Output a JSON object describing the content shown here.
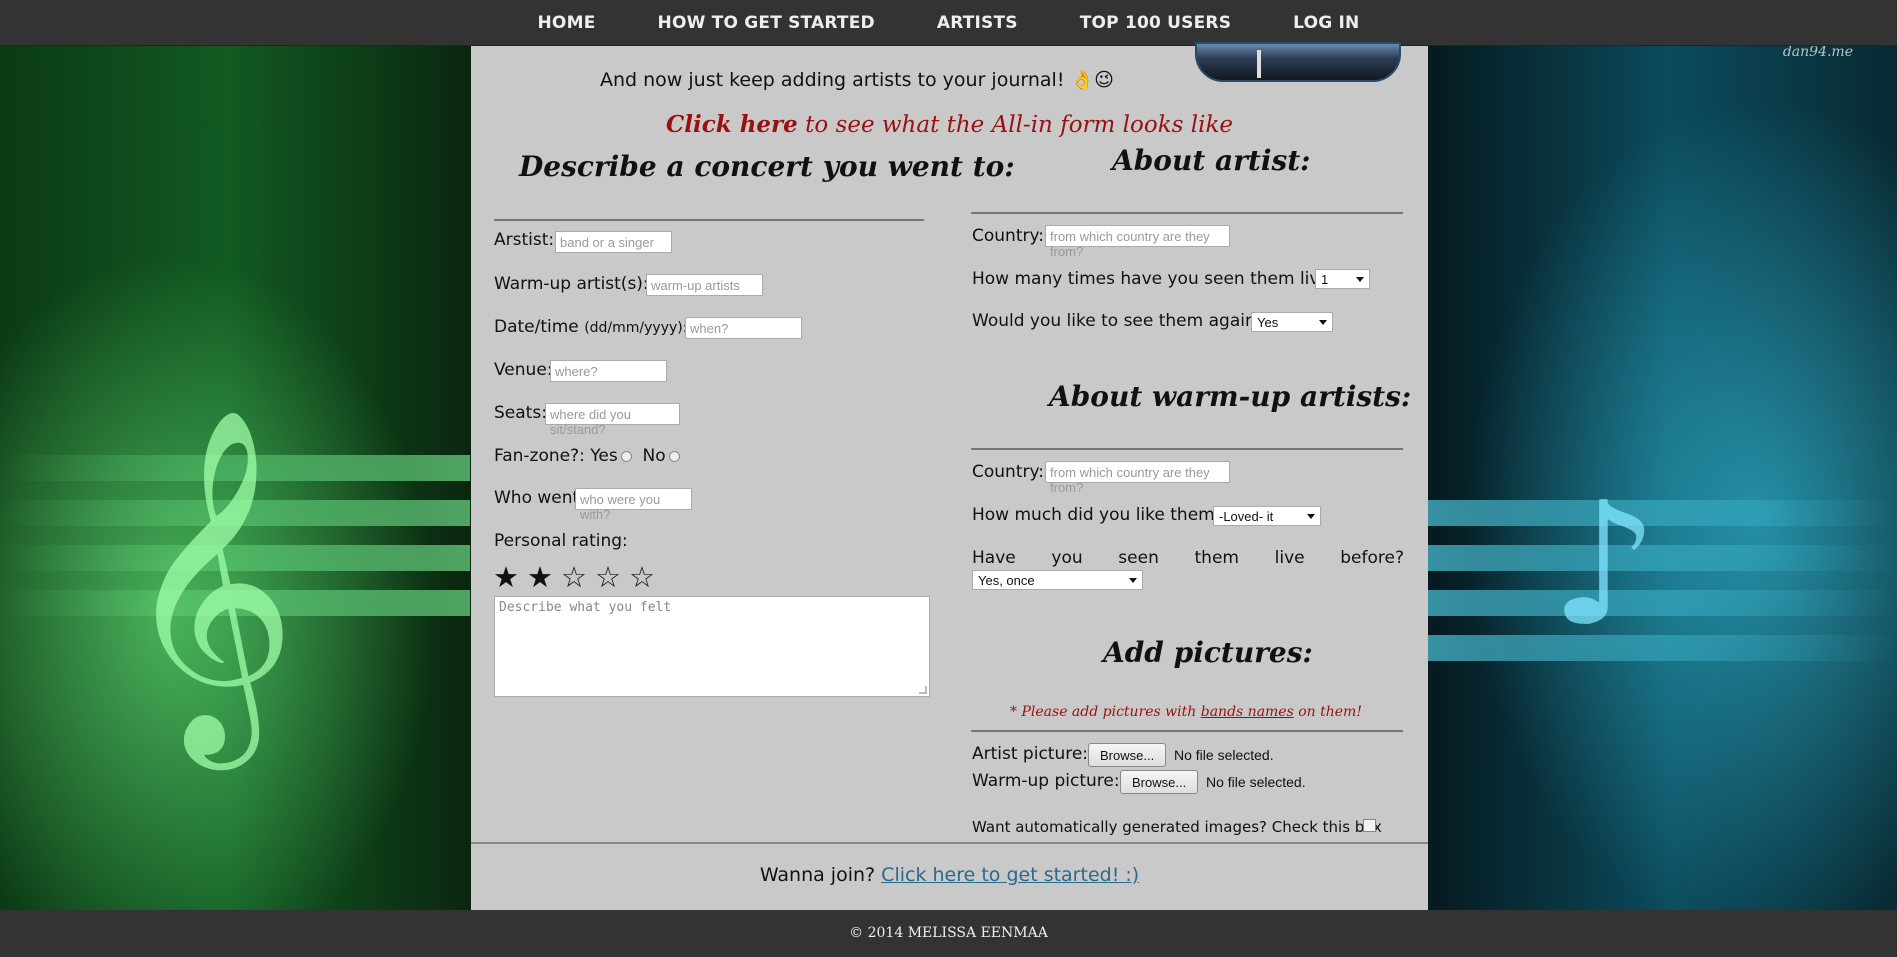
{
  "nav": {
    "items": [
      {
        "label": "HOME"
      },
      {
        "label": "HOW TO GET STARTED"
      },
      {
        "label": "ARTISTS"
      },
      {
        "label": "TOP 100 USERS"
      },
      {
        "label": "LOG IN"
      }
    ]
  },
  "watermark": "dan94.me",
  "intro": "And now just keep adding artists to your journal! 👌😉",
  "allin": {
    "link": "Click here",
    "text": " to see what the All-in form looks like"
  },
  "concert": {
    "title": "Describe a concert you went to:",
    "artist": {
      "label": "Arstist:",
      "placeholder": "band or a singer"
    },
    "warmup": {
      "label": "Warm-up artist(s):",
      "placeholder": "warm-up artists"
    },
    "date": {
      "label": "Date/time",
      "hint": "(dd/mm/yyyy):",
      "placeholder": "when?"
    },
    "venue": {
      "label": "Venue:",
      "placeholder": "where?"
    },
    "seats": {
      "label": "Seats:",
      "placeholder": "where did you sit/stand?"
    },
    "fanzone": {
      "label": "Fan-zone?: Yes",
      "no": "No"
    },
    "who": {
      "label": "Who went:",
      "placeholder": "who were you with?"
    },
    "rating": {
      "label": "Personal rating:",
      "value": 2,
      "max": 5
    },
    "description_placeholder": "Describe what you felt"
  },
  "about_artist": {
    "title": "About artist:",
    "country": {
      "label": "Country:",
      "placeholder": "from which country are they from?"
    },
    "times": {
      "label": "How many times have you seen them live?",
      "value": "1"
    },
    "again": {
      "label": "Would you like to see them again?",
      "value": "Yes"
    }
  },
  "about_warmup": {
    "title": "About warm-up artists:",
    "country": {
      "label": "Country:",
      "placeholder": "from which country are they from?"
    },
    "liked": {
      "label": "How much did you like them?",
      "value": "-Loved- it"
    },
    "seen_words": [
      "Have",
      "you",
      "seen",
      "them",
      "live",
      "before?"
    ],
    "seen_value": "Yes, once"
  },
  "pictures": {
    "title": "Add pictures:",
    "warn_prefix": "* Please add pictures with ",
    "warn_link": "bands names",
    "warn_suffix": " on them!",
    "artist_label": "Artist picture:",
    "warmup_label": "Warm-up picture:",
    "browse": "Browse...",
    "nofile": "No file selected.",
    "auto_label": "Want automatically generated images? Check this box"
  },
  "join": {
    "text": "Wanna join? ",
    "link": "Click here to get started! :)"
  },
  "footer": "© 2014 MELISSA EENMAA"
}
